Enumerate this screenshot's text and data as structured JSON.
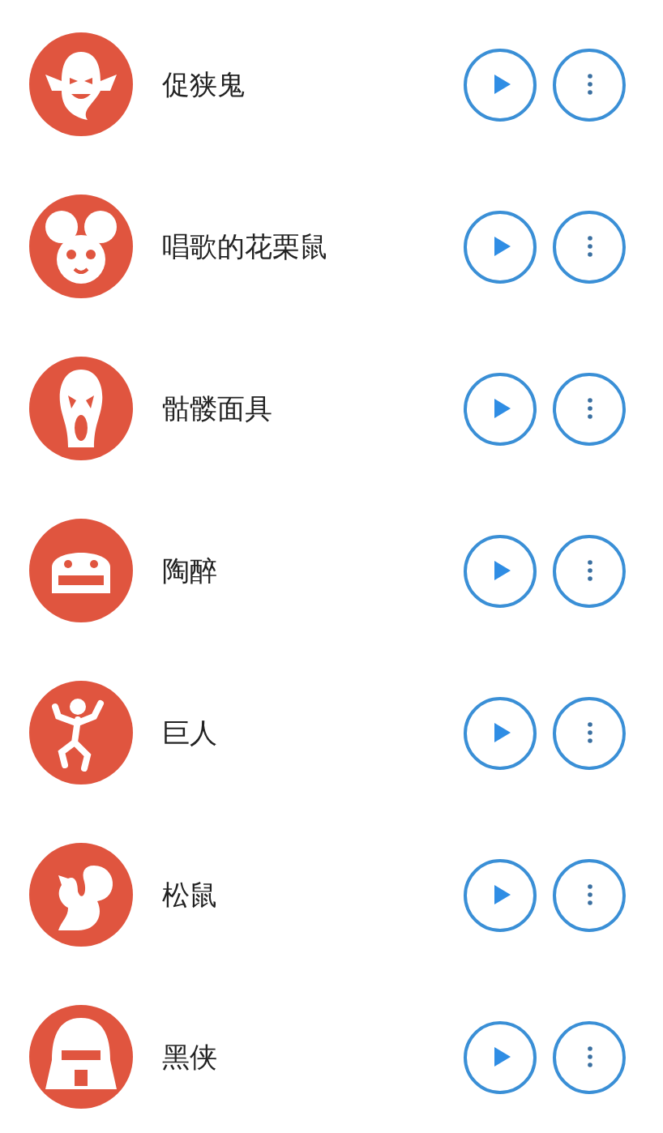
{
  "sounds": [
    {
      "name": "促狭鬼"
    },
    {
      "name": "唱歌的花栗鼠"
    },
    {
      "name": "骷髅面具"
    },
    {
      "name": "陶醉"
    },
    {
      "name": "巨人"
    },
    {
      "name": "松鼠"
    },
    {
      "name": "黑侠"
    }
  ]
}
